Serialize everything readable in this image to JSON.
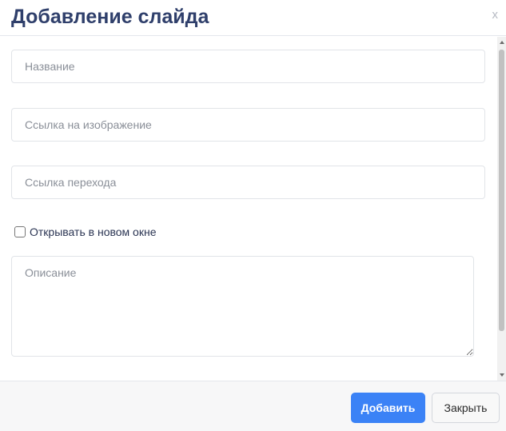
{
  "modal": {
    "title": "Добавление слайда",
    "close_symbol": "x"
  },
  "form": {
    "name_placeholder": "Название",
    "image_link_placeholder": "Ссылка на изображение",
    "target_link_placeholder": "Ссылка перехода",
    "new_window_label": "Открывать в новом окне",
    "new_window_checked": false,
    "description_placeholder": "Описание"
  },
  "footer": {
    "add_label": "Добавить",
    "close_label": "Закрыть"
  },
  "colors": {
    "title": "#2f3f6b",
    "primary": "#3b82f6"
  }
}
